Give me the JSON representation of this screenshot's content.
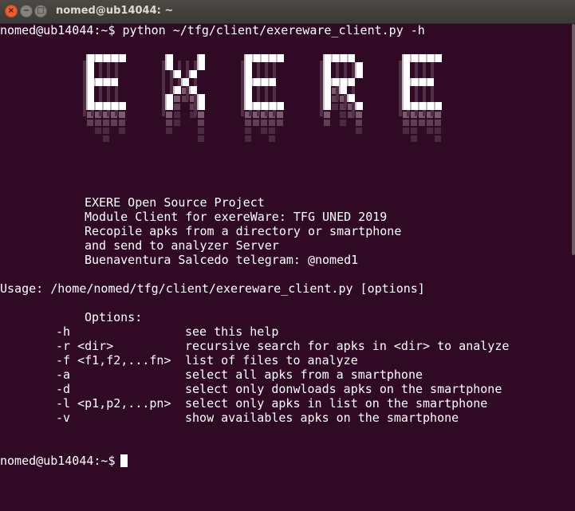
{
  "window": {
    "title": "nomed@ub14044: ~",
    "close_glyph": "×",
    "min_glyph": "−",
    "max_glyph": "□"
  },
  "terminal": {
    "command_line": "nomed@ub14044:~$ python ~/tfg/client/exereware_client.py -h",
    "banner_art": "EXERE",
    "info_lines": [
      "EXERE Open Source Project",
      "Module Client for exereWare: TFG UNED 2019",
      "Recopile apks from a directory or smartphone",
      "and send to analyzer Server",
      "Buenaventura Salcedo telegram: @nomed1"
    ],
    "usage": "Usage: /home/nomed/tfg/client/exereware_client.py [options]",
    "options_title": "Options:",
    "options": [
      {
        "flag": "-h",
        "desc": "see this help"
      },
      {
        "flag": "-r <dir>",
        "desc": "recursive search for apks in <dir> to analyze"
      },
      {
        "flag": "-f <f1,f2,...fn>",
        "desc": "list of files to analyze"
      },
      {
        "flag": "-a",
        "desc": "select all apks from a smartphone"
      },
      {
        "flag": "-d",
        "desc": "select only donwloads apks on the smartphone"
      },
      {
        "flag": "-l <p1,p2,...pn>",
        "desc": "select only apks in list on the smartphone"
      },
      {
        "flag": "-v",
        "desc": "show availables apks on the smartphone"
      }
    ],
    "prompt": "nomed@ub14044:~$"
  },
  "colors": {
    "background": "#300a24",
    "text": "#ffffff",
    "titlebar": "#3c3b37",
    "close_button": "#ec5e2e"
  }
}
